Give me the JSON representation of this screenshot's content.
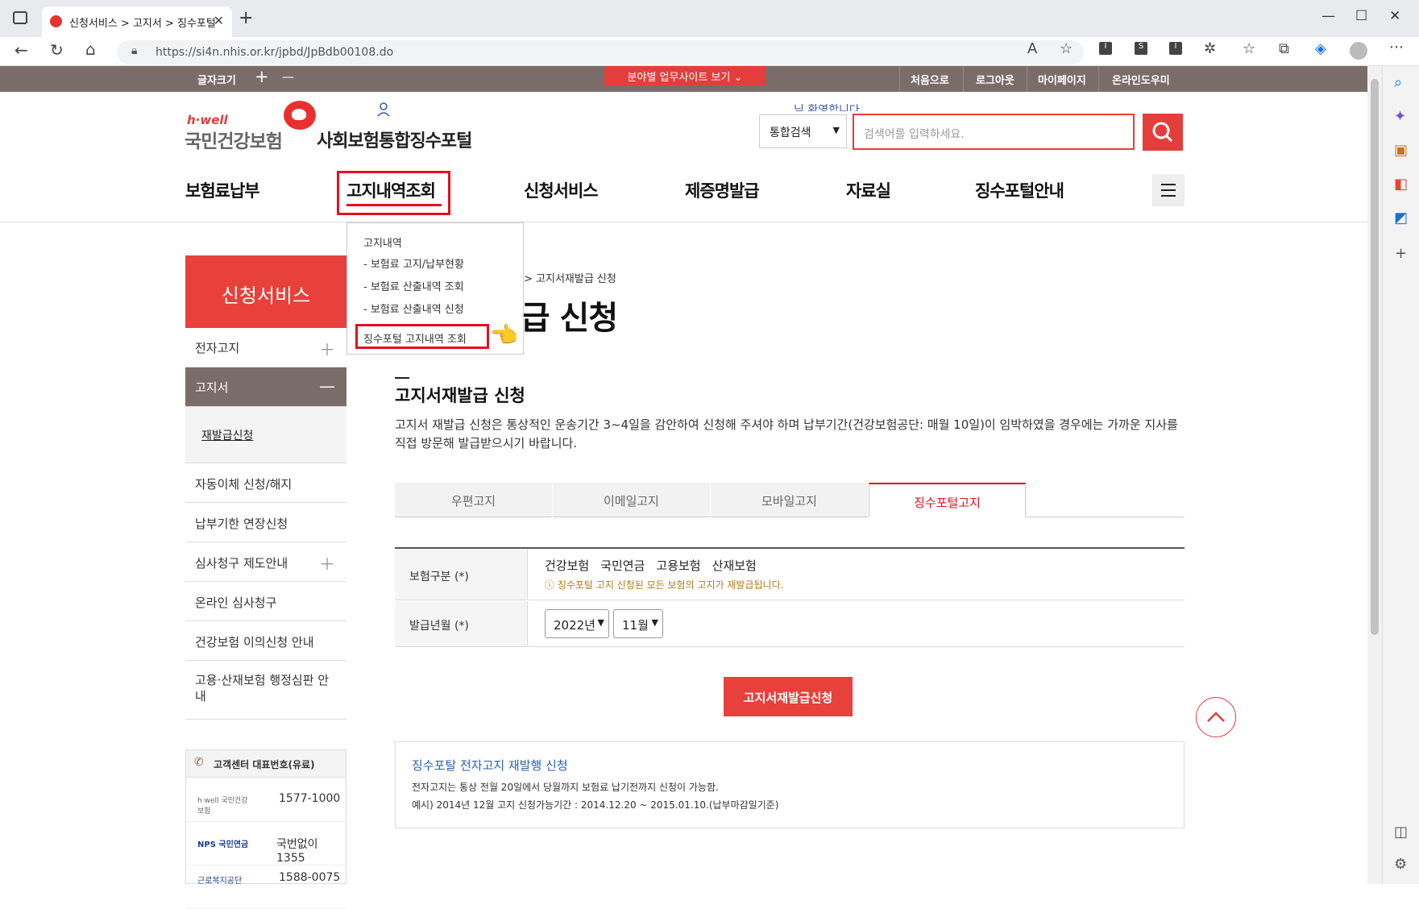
{
  "browser": {
    "tab_title": "신청서비스 > 고지서 > 징수포털",
    "url": "https://si4n.nhis.or.kr/jpbd/JpBdb00108.do"
  },
  "topbar": {
    "font_size_label": "글자크기",
    "plus": "+",
    "minus": "—",
    "field_sites": "분야별 업무사이트 보기",
    "links": [
      "처음으로",
      "로그아웃",
      "마이페이지",
      "온라인도우미"
    ]
  },
  "header": {
    "logo_top": "h·well",
    "logo_main": "국민건강보험",
    "portal_name": "사회보험통합징수포털",
    "welcome": "님 환영합니다",
    "search_type": "통합검색",
    "search_placeholder": "검색어를 입력하세요."
  },
  "gnb": [
    "보험료납부",
    "고지내역조회",
    "신청서비스",
    "제증명발급",
    "자료실",
    "징수포털안내"
  ],
  "dropdown": {
    "heading": "고지내역",
    "items": [
      "- 보험료 고지/납부현황",
      "- 보험료 산출내역 조회",
      "- 보험료 산출내역 신청",
      "징수포털 고지내역 조회"
    ],
    "pointer": "👈"
  },
  "lnb": {
    "title": "신청서비스",
    "items": [
      "전자고지",
      "고지서",
      "재발급신청",
      "자동이체 신청/해지",
      "납부기한 연장신청",
      "심사청구 제도안내",
      "온라인 심사청구",
      "건강보험 이의신청 안내",
      "고용·산재보험 행정심판 안내"
    ]
  },
  "customer_center": {
    "title": "고객센터 대표번호(유료)",
    "rows": [
      {
        "org": "h·well 국민건강보험",
        "phone": "1577-1000"
      },
      {
        "org": "NPS 국민연금",
        "phone": "국번없이1355"
      },
      {
        "org": "근로복지공단",
        "phone": "1588-0075"
      }
    ]
  },
  "content": {
    "breadcrumb": "> 고지서재발급 신청",
    "page_title": "발급 신청",
    "section_title": "고지서재발급 신청",
    "description": "고지서 재발급 신청은 통상적인 운송기간 3~4일을 감안하여 신청해 주셔야 하며 납부기간(건강보험공단: 매월 10일)이 임박하였을 경우에는 가까운 지사를 직접 방문해 발급받으시기 바랍니다.",
    "tabs": [
      "우편고지",
      "이메일고지",
      "모바일고지",
      "징수포털고지"
    ],
    "form": {
      "insurance_label": "보험구분 (*)",
      "insurances": [
        "건강보험",
        "국민연금",
        "고용보험",
        "산재보험"
      ],
      "insurance_note": "ⓘ 징수포털 고지 신청된 모든 보험의 고지가 재발급됩니다.",
      "date_label": "발급년월 (*)",
      "year": "2022년",
      "month": "11월"
    },
    "submit": "고지서재발급신청",
    "info": {
      "title": "징수포탈 전자고지 재발행 신청",
      "lines": [
        "전자고지는 통상 전월 20일에서 당월까지 보험료 납기전까지 신청이 가능함.",
        "예시) 2014년 12월 고지 신청가능기간 : 2014.12.20 ~ 2015.01.10.(납부마감일기준)"
      ]
    }
  }
}
